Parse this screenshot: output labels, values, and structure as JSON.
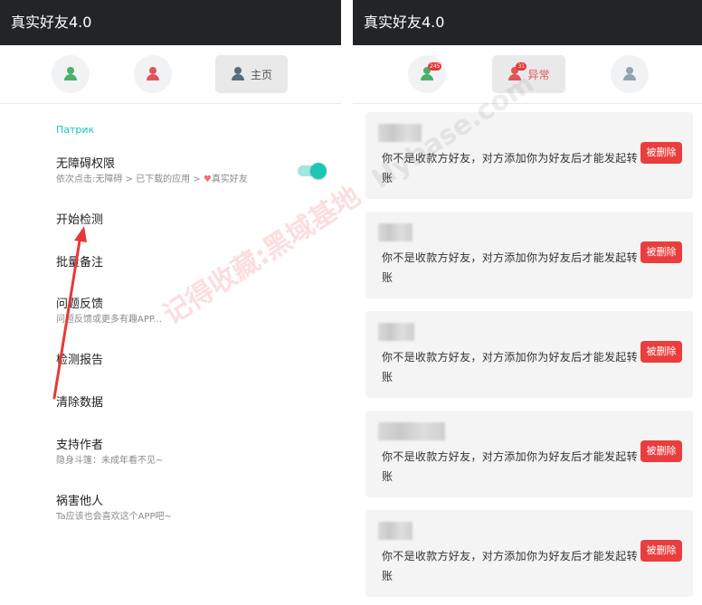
{
  "left": {
    "app_title": "真实好友4.0",
    "tabs": [
      {
        "icon": "person-icon",
        "color": "#4caf6a",
        "label": ""
      },
      {
        "icon": "person-icon",
        "color": "#e0555a",
        "label": ""
      },
      {
        "icon": "person-icon",
        "color": "#546e7a",
        "label": "主页"
      }
    ],
    "section_title": "Патрик",
    "items": [
      {
        "title": "无障碍权限",
        "subtitle_prefix": "依次点击:无障碍 > 已下载的应用 > ",
        "subtitle_heart": "♥",
        "subtitle_suffix": "真实好友",
        "toggle_on": true
      },
      {
        "title": "开始检测"
      },
      {
        "title": "批量备注"
      },
      {
        "title": "问题反馈",
        "subtitle": "问题反馈或更多有趣APP..."
      },
      {
        "title": "检测报告"
      },
      {
        "title": "清除数据"
      },
      {
        "title": "支持作者",
        "subtitle": "隐身斗篷：未成年看不见~"
      },
      {
        "title": "祸害他人",
        "subtitle": "Ta应该也会喜欢这个APP吧~"
      }
    ],
    "accent_color": "#1cc6b5"
  },
  "right": {
    "app_title": "真实好友4.0",
    "tabs": [
      {
        "icon": "person-icon",
        "color": "#4caf6a",
        "badge": "245",
        "label": ""
      },
      {
        "icon": "person-icon",
        "color": "#e0555a",
        "badge": "31",
        "label": "异常"
      },
      {
        "icon": "person-icon",
        "color": "#90a4ae",
        "label": ""
      }
    ],
    "cards": [
      {
        "message": "你不是收款方好友，对方添加你为好友后才能发起转账",
        "button": "被删除"
      },
      {
        "message": "你不是收款方好友，对方添加你为好友后才能发起转账",
        "button": "被删除"
      },
      {
        "message": "你不是收款方好友，对方添加你为好友后才能发起转账",
        "button": "被删除"
      },
      {
        "message": "你不是收款方好友，对方添加你为好友后才能发起转账",
        "button": "被删除"
      },
      {
        "message": "你不是收款方好友，对方添加你为好友后才能发起转账",
        "button": "被删除"
      }
    ],
    "button_color": "#ea3d3d"
  },
  "annotation": {
    "arrow_color": "#e53935"
  },
  "watermark": {
    "text_cn": "记得收藏:黑域基地",
    "text_en": "Hybase.com"
  }
}
